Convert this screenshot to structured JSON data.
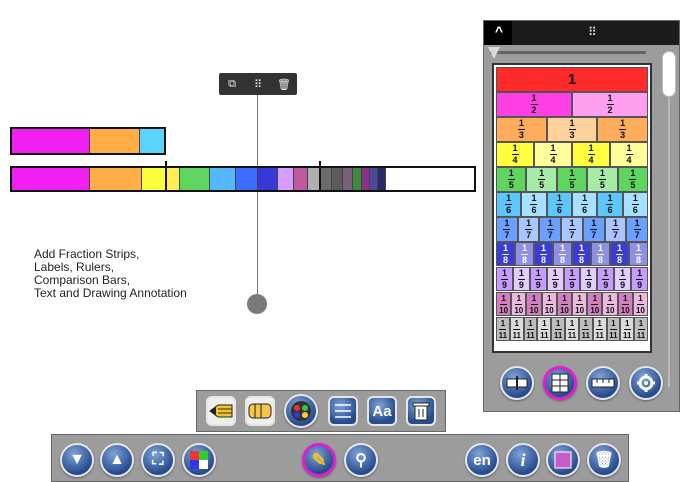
{
  "canvas": {
    "annotation_text": "Add Fraction Strips,\nLabels, Rulers,\nComparison Bars,\nText and Drawing Annotation",
    "float_toolbar": {
      "icons": [
        "copy-icon",
        "grip-icon",
        "trash-icon"
      ],
      "grip_glyph": "⠿",
      "copy_glyph": "⧉",
      "trash_glyph": "🗑"
    },
    "strip_top_colors": [
      "#f21ff2",
      "#ffad46",
      "#5bd5ff"
    ],
    "strip_long_colors": [
      "#f21ff2",
      "#ffad46",
      "#fbff3b",
      "#fff04f",
      "#5ed55e",
      "#55b8ff",
      "#3c6bff",
      "#3838d8",
      "#d69cff",
      "#c05aa0",
      "#b0b0b0",
      "#6b6b6b",
      "#5b5b5b",
      "#7a5f7a",
      "#3d8a3d",
      "#8a2f8a",
      "#4a4a9a",
      "#2a2a6a"
    ]
  },
  "panel": {
    "caret": "^",
    "grip": "⠿",
    "rows": [
      {
        "den": 1,
        "color": "#ff2b2b",
        "label": "1"
      },
      {
        "den": 2,
        "color": "#ff3fe6",
        "alt": "#ff9ff2"
      },
      {
        "den": 3,
        "color": "#ffad5c",
        "alt": "#ffd19c"
      },
      {
        "den": 4,
        "color": "#ffff3d",
        "alt": "#ffff9a"
      },
      {
        "den": 5,
        "color": "#5ed55e",
        "alt": "#a6eba6"
      },
      {
        "den": 6,
        "color": "#5cc6ff",
        "alt": "#a6e1ff"
      },
      {
        "den": 7,
        "color": "#6aa0ff",
        "alt": "#aac6ff"
      },
      {
        "den": 8,
        "color": "#3b3bd6",
        "alt": "#8f8fe6"
      },
      {
        "den": 9,
        "color": "#c79cff",
        "alt": "#e3ccff"
      },
      {
        "den": 10,
        "color": "#d27fbf",
        "alt": "#ebb8de"
      },
      {
        "den": 11,
        "color": "#bdbdbd",
        "alt": "#dcdcdc"
      }
    ],
    "buttons": [
      "strip-label-icon",
      "fraction-wall-icon",
      "ruler-icon",
      "gear-icon"
    ]
  },
  "draw_toolbar": {
    "buttons": [
      "pencils-icon",
      "eraser-icon",
      "color-wheel-icon",
      "lines-icon",
      "text-icon",
      "clear-trash-icon"
    ],
    "text_label": "Aa"
  },
  "main_toolbar": {
    "buttons": {
      "down": "▼",
      "up": "▲",
      "fit": "⛶",
      "colors": "colors",
      "pencil": "✎",
      "pin": "⚲",
      "lang": "en",
      "info": "i",
      "frame": "frame",
      "trash": "🗑"
    }
  }
}
